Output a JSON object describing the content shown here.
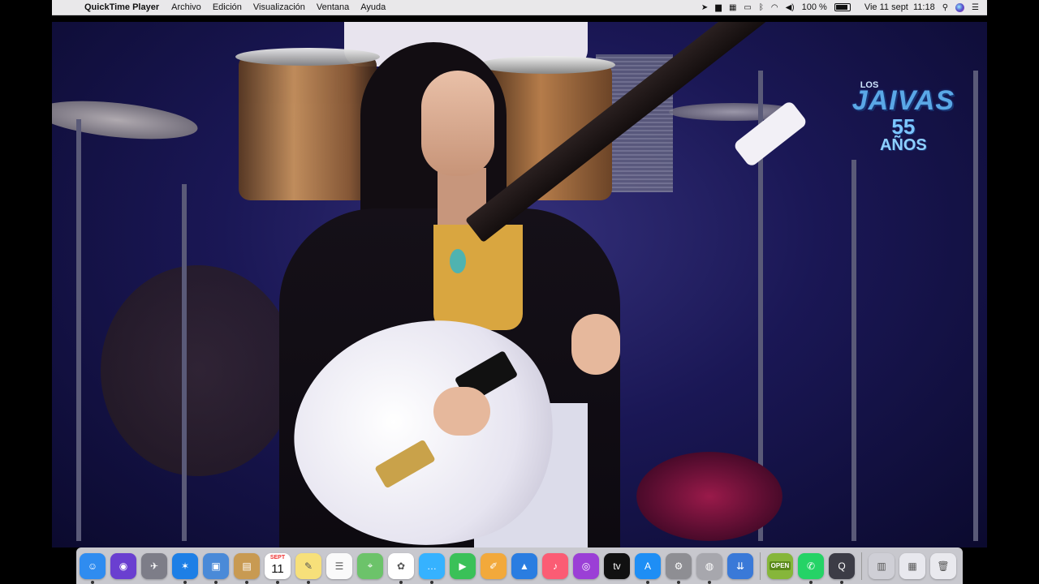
{
  "menubar": {
    "app_name": "QuickTime Player",
    "menus": [
      "Archivo",
      "Edición",
      "Visualización",
      "Ventana",
      "Ayuda"
    ],
    "battery": "100 %",
    "datetime": "Vie 11 sept  11:18"
  },
  "video": {
    "logo": {
      "los": "LOS",
      "title": "JAIVAS",
      "number": "55",
      "anos": "AÑOS"
    }
  },
  "dock": {
    "calendar": {
      "month": "SEPT",
      "day": "11"
    },
    "open_badge": "OPEN",
    "items": [
      {
        "name": "finder-icon",
        "color": "#2f8cf0"
      },
      {
        "name": "siri-icon",
        "color": "#6a3fd0"
      },
      {
        "name": "launchpad-icon",
        "color": "#7d7d88"
      },
      {
        "name": "safari-icon",
        "color": "#1d7fe6"
      },
      {
        "name": "preview-icon",
        "color": "#4a8ad8"
      },
      {
        "name": "contacts-icon",
        "color": "#c89a52"
      },
      {
        "name": "calendar-icon",
        "color": "#ffffff"
      },
      {
        "name": "notes-icon",
        "color": "#f7e07a"
      },
      {
        "name": "reminders-icon",
        "color": "#fafafa"
      },
      {
        "name": "maps-icon",
        "color": "#6cc36a"
      },
      {
        "name": "photos-icon",
        "color": "#ffffff"
      },
      {
        "name": "messages-icon",
        "color": "#36b2ff"
      },
      {
        "name": "facetime-icon",
        "color": "#3ac158"
      },
      {
        "name": "pages-icon",
        "color": "#f2a93b"
      },
      {
        "name": "keynote-icon",
        "color": "#2a7de1"
      },
      {
        "name": "music-icon",
        "color": "#fb5c74"
      },
      {
        "name": "podcasts-icon",
        "color": "#9b3fd6"
      },
      {
        "name": "apple-tv-icon",
        "color": "#111111"
      },
      {
        "name": "app-store-icon",
        "color": "#1e8ef5"
      },
      {
        "name": "system-preferences-icon",
        "color": "#8e8e93"
      },
      {
        "name": "disk-utility-icon",
        "color": "#a7a7ad"
      },
      {
        "name": "downloads-stack-icon",
        "color": "#3a79d8"
      },
      {
        "name": "open-app-icon",
        "color": "#86b63a"
      },
      {
        "name": "whatsapp-icon",
        "color": "#25d366"
      },
      {
        "name": "quicktime-icon",
        "color": "#3c3c46"
      },
      {
        "name": "folder-stack-icon",
        "color": "#cfcfd6"
      },
      {
        "name": "documents-stack-icon",
        "color": "#e8e8ee"
      },
      {
        "name": "trash-icon",
        "color": "#e9e9ee"
      }
    ]
  }
}
